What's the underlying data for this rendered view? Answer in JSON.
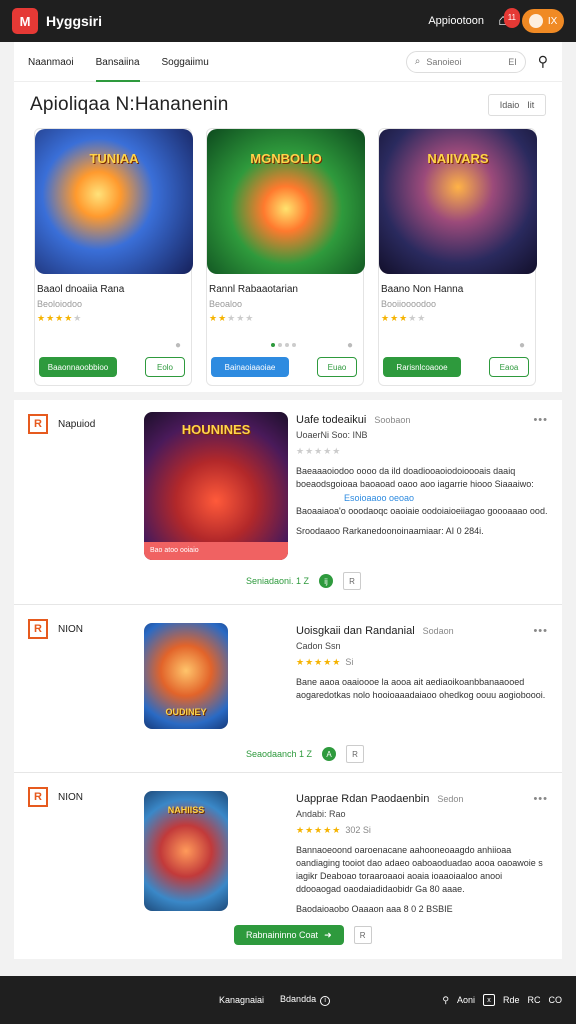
{
  "topbar": {
    "logo": "M",
    "brand": "Hyggsiri",
    "link": "Appiootoon",
    "notif_count": "11",
    "avatar_text": "IX"
  },
  "nav": {
    "tabs": [
      "Naanmaoi",
      "Bansaiina",
      "Soggaiimu"
    ],
    "active_index": 1,
    "search_placeholder": "Sanoieoi",
    "search_suffix": "EI"
  },
  "page": {
    "title": "Apioliqaa N:Hananenin",
    "sort_label": "Idaio",
    "sort_icon": "Iit"
  },
  "cards": [
    {
      "art": "TUNIAA",
      "name": "Baaol dnoaiia Rana",
      "sub": "Beoloiodoo",
      "stars": 4,
      "btn": "Baaonnaoobbioo",
      "btn2": "Eolo",
      "btn_color": "green"
    },
    {
      "art": "MGNBOLIO",
      "name": "Rannl Rabaaotarian",
      "sub": "Beoaloo",
      "stars": 2,
      "btn": "Bainaoiaaoiae",
      "btn2": "Euao",
      "btn_color": "blue"
    },
    {
      "art": "NAIIVARS",
      "name": "Baano Non Hanna",
      "sub": "Booiioooodoo",
      "stars": 3,
      "btn": "Rarisnlcoaooe",
      "btn2": "Eaoa",
      "btn_color": "green"
    }
  ],
  "list": [
    {
      "tag": "Napuiod",
      "art": "HOUNINES",
      "band": "Bao atoo ooiaio",
      "title": "Uafe todeaikui",
      "dev": "Soobaon",
      "meta": "UoaerNi Soo: INB",
      "stars": 0,
      "desc": "Baeaaaoiodoo oooo da ild doadiooaoiodoioooais daaiq boeaodsgoioaa baoaoad oaoo aoo iagarrie hiooo Siaaaiwo:",
      "link": "Esoioaaoo oeoao",
      "desc2": "Baoaaiaoa'o ooodaoqc oaoiaie oodoiaioeiiagao goooaaao ood.",
      "foot": "Sroodaaoo Rarkanedoonoinaamiaar: AI 0 284i.",
      "action_label": "Seniadaoni. 1 Z",
      "action_icon": "ij",
      "square_icon": "R"
    },
    {
      "tag": "NION",
      "art": "OUDINEY",
      "title": "Uoisgkaii dan Randanial",
      "dev": "Sodaon",
      "meta": "Cadon Ssn",
      "stars": 5,
      "count": "Si",
      "desc": "Bane aaoa oaaioooe la aooa ait aediaoikoanbbanaaooed aogaredotkas nolo hooioaaadaiaoo ohedkog oouu aogioboooi.",
      "action_label": "Seaodaanch 1 Z",
      "action_icon": "A",
      "square_icon": "R"
    },
    {
      "tag": "NION",
      "art": "NAHIISS",
      "title": "Uapprae Rdan Paodaenbin",
      "dev": "Sedon",
      "meta": "Andabi: Rao",
      "stars": 5,
      "count": "302 Si",
      "desc": "Bannaoeoond oaroenacane aahooneoaagdo anhiioaa oandiaging tooiot dao adaeo oaboaoduadao aooa oaoawoie s iagikr Deaboao toraaroaaoi aoaia ioaaoiaaloo anooi ddooaogad oaodaiadidaobidr Ga 80 aaae.",
      "foot": "Baodaioaobo Oaaaon aaa 8 0 2 BSBIE",
      "button_label": "Rabnaininno Coat",
      "square_icon": "R"
    }
  ],
  "footer": {
    "left": "Kanagnaiai",
    "mid": "Bdandda",
    "items": [
      "Aoni",
      "Rde",
      "RC",
      "CO"
    ]
  },
  "colors": {
    "accent_green": "#2e9a3d",
    "accent_blue": "#2e8be0",
    "brand_red": "#e53935",
    "avatar_orange": "#f08a24",
    "topbar": "#1f1f1f"
  }
}
